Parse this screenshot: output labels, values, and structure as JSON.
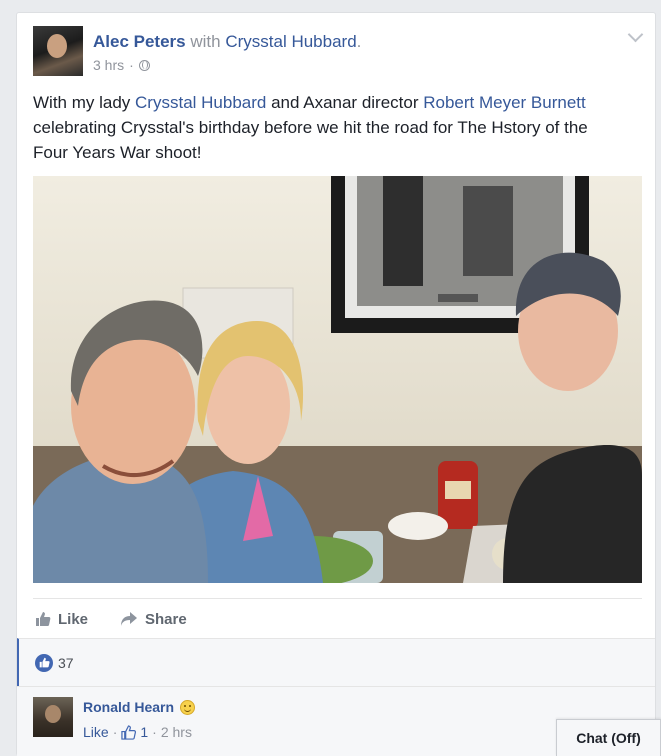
{
  "post": {
    "author": "Alec Peters",
    "with_word": "with",
    "tagged": "Crysstal Hubbard",
    "period": ".",
    "time": "3 hrs",
    "dot": "·",
    "text_1": "With my lady ",
    "text_link_1": "Crysstal Hubbard",
    "text_2": " and Axanar director ",
    "text_link_2": "Robert Meyer Burnett",
    "text_3": " celebrating Crysstal's birthday before we hit the road for The Hstory of the Four Years War shoot!"
  },
  "actions": {
    "like_label": "Like",
    "share_label": "Share"
  },
  "reactions": {
    "count": "37"
  },
  "comment": {
    "name": "Ronald Hearn",
    "like_label": "Like",
    "sep": "·",
    "like_count": "1",
    "time": "2 hrs"
  },
  "chat": {
    "label": "Chat (Off)"
  },
  "colors": {
    "link": "#365899",
    "meta": "#90949c",
    "like_blue": "#4267b2"
  },
  "icons": [
    "globe-icon",
    "chevron-down-icon",
    "like-icon",
    "share-icon",
    "like-bubble-icon",
    "smiley-icon"
  ]
}
